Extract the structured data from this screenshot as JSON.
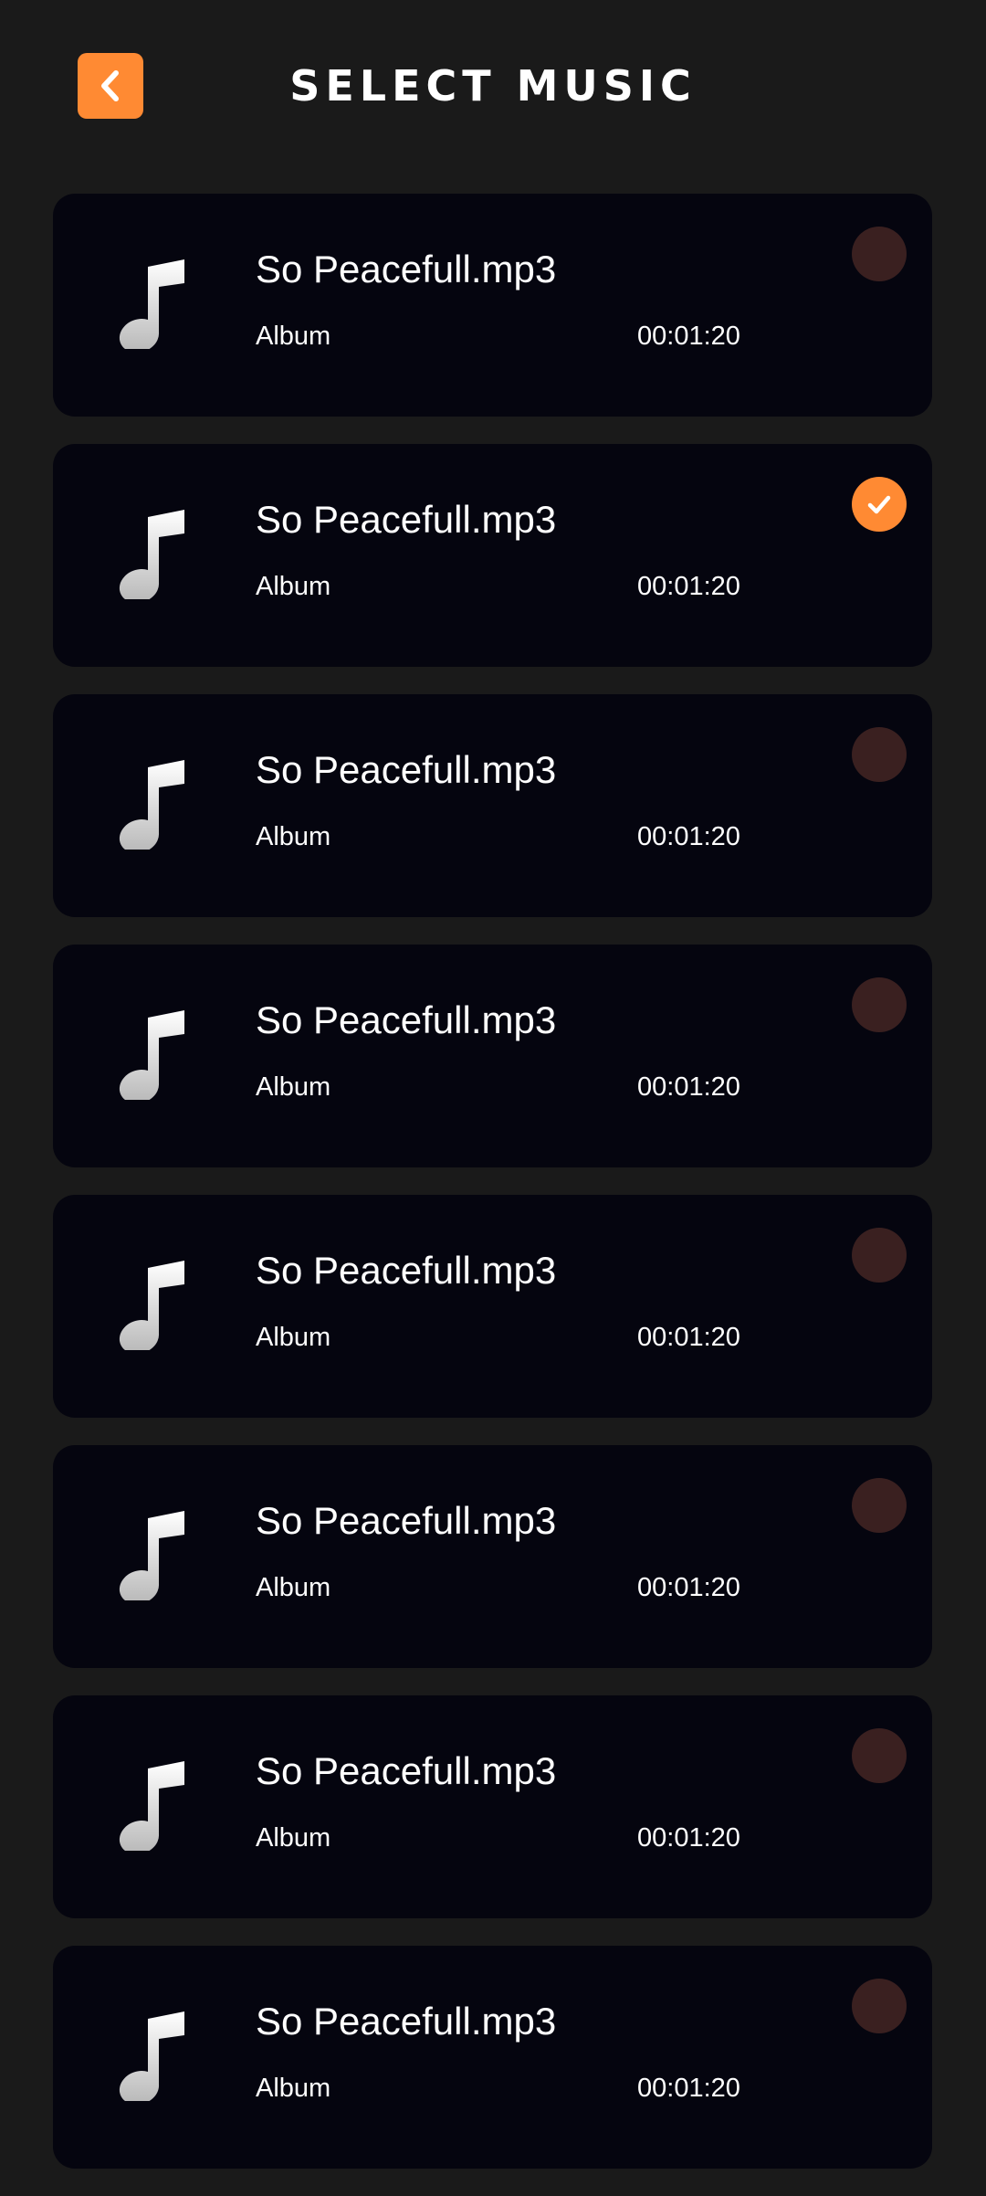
{
  "header": {
    "title": "SELECT MUSIC",
    "back_icon": "chevron-left-icon"
  },
  "colors": {
    "accent": "#ff8a33",
    "background": "#1a1a1a",
    "card": "#05050f",
    "unselected_circle": "#3a2020"
  },
  "songs": [
    {
      "title": "So Peacefull.mp3",
      "album": "Album",
      "duration": "00:01:20",
      "selected": false
    },
    {
      "title": "So Peacefull.mp3",
      "album": "Album",
      "duration": "00:01:20",
      "selected": true
    },
    {
      "title": "So Peacefull.mp3",
      "album": "Album",
      "duration": "00:01:20",
      "selected": false
    },
    {
      "title": "So Peacefull.mp3",
      "album": "Album",
      "duration": "00:01:20",
      "selected": false
    },
    {
      "title": "So Peacefull.mp3",
      "album": "Album",
      "duration": "00:01:20",
      "selected": false
    },
    {
      "title": "So Peacefull.mp3",
      "album": "Album",
      "duration": "00:01:20",
      "selected": false
    },
    {
      "title": "So Peacefull.mp3",
      "album": "Album",
      "duration": "00:01:20",
      "selected": false
    },
    {
      "title": "So Peacefull.mp3",
      "album": "Album",
      "duration": "00:01:20",
      "selected": false
    }
  ]
}
